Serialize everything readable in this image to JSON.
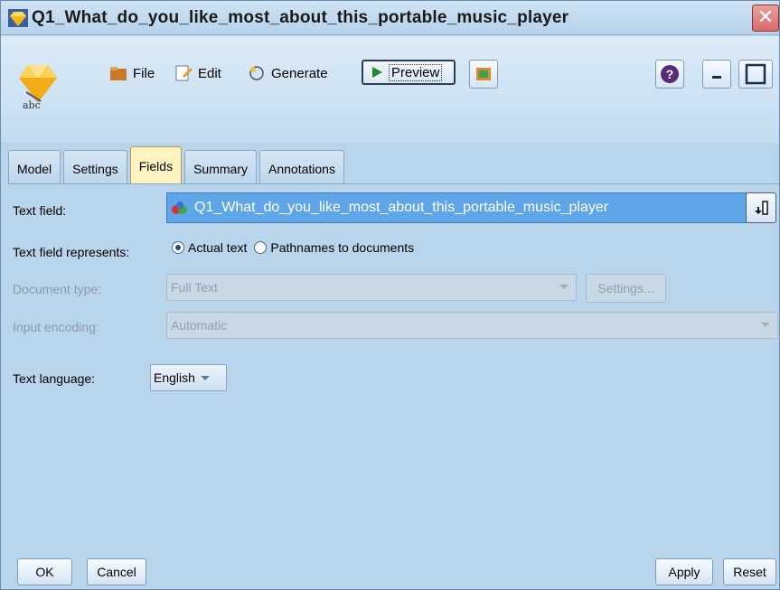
{
  "window": {
    "title": "Q1_What_do_you_like_most_about_this_portable_music_player"
  },
  "node": {
    "caption": "abc"
  },
  "toolbar": {
    "file_label": "File",
    "edit_label": "Edit",
    "generate_label": "Generate",
    "preview_label": "Preview"
  },
  "tabs": [
    {
      "label": "Model"
    },
    {
      "label": "Settings"
    },
    {
      "label": "Fields",
      "active": true
    },
    {
      "label": "Summary"
    },
    {
      "label": "Annotations"
    }
  ],
  "form": {
    "text_field_label": "Text field:",
    "text_field_value": "Q1_What_do_you_like_most_about_this_portable_music_player",
    "represents_label": "Text field represents:",
    "represents_options": [
      "Actual text",
      "Pathnames to documents"
    ],
    "represents_selected": "Actual text",
    "doc_type_label": "Document type:",
    "doc_type_value": "Full Text",
    "settings_label": "Settings...",
    "encoding_label": "Input encoding:",
    "encoding_value": "Automatic",
    "language_label": "Text language:",
    "language_value": "English"
  },
  "footer": {
    "ok_label": "OK",
    "cancel_label": "Cancel",
    "apply_label": "Apply",
    "reset_label": "Reset"
  }
}
